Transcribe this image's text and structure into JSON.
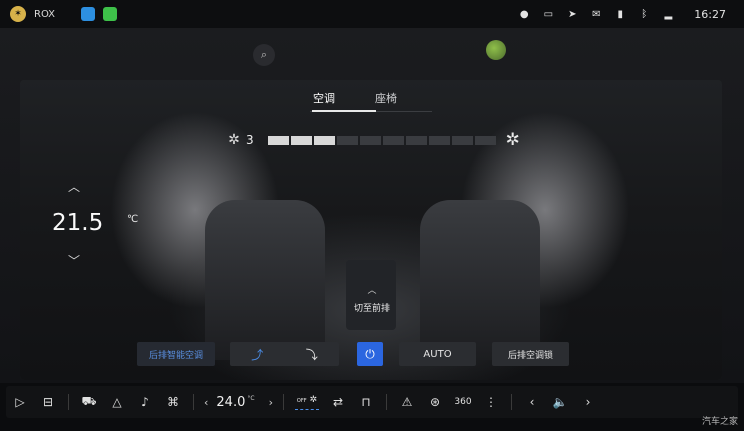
{
  "status_bar": {
    "brand": "ROX",
    "time": "16:27",
    "icons": [
      "microphone-icon",
      "camera-icon",
      "navigation-icon",
      "message-icon",
      "battery-icon",
      "bluetooth-icon",
      "signal-icon"
    ]
  },
  "panel": {
    "tabs": [
      {
        "label": "空调",
        "active": true
      },
      {
        "label": "座椅",
        "active": false
      }
    ],
    "fan": {
      "level": "3",
      "segments_total": 10,
      "segments_on": 3
    },
    "temperature": {
      "value": "21.5",
      "unit": "℃"
    },
    "switch_front": "切至前排",
    "controls": {
      "smart_rear": "后排智能空调",
      "auto": "AUTO",
      "rear_lock": "后排空调锁"
    },
    "colors": {
      "accent_blue": "#2b66e0",
      "active_blue": "#4a8de8"
    }
  },
  "dock": {
    "temperature": "24.0",
    "temperature_unit": "°C",
    "fan_label": "OFF"
  },
  "watermark": "汽车之家"
}
